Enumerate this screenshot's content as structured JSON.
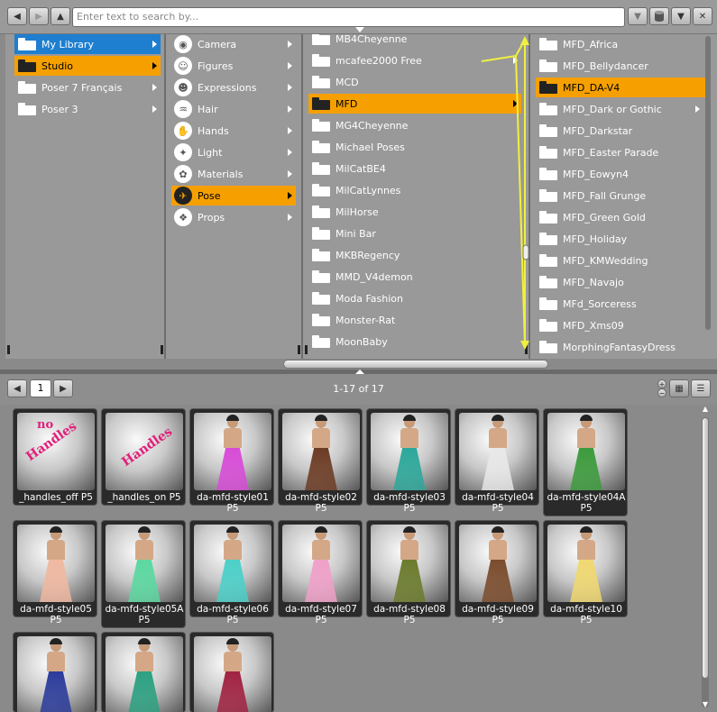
{
  "toolbar": {
    "search_placeholder": "Enter text to search by..."
  },
  "col1": {
    "items": [
      {
        "label": "My Library",
        "state": "selected-blue"
      },
      {
        "label": "Studio",
        "state": "selected"
      },
      {
        "label": "Poser 7 Français",
        "state": ""
      },
      {
        "label": "Poser 3",
        "state": ""
      }
    ]
  },
  "col2": {
    "items": [
      {
        "label": "Camera",
        "icon": "camera-icon"
      },
      {
        "label": "Figures",
        "icon": "figure-icon"
      },
      {
        "label": "Expressions",
        "icon": "face-icon"
      },
      {
        "label": "Hair",
        "icon": "hair-icon"
      },
      {
        "label": "Hands",
        "icon": "hand-icon"
      },
      {
        "label": "Light",
        "icon": "light-icon"
      },
      {
        "label": "Materials",
        "icon": "materials-icon"
      },
      {
        "label": "Pose",
        "icon": "pose-icon",
        "selected": true
      },
      {
        "label": "Props",
        "icon": "props-icon"
      }
    ]
  },
  "col3": {
    "items": [
      {
        "label": "MB4Cheyenne"
      },
      {
        "label": "mcafee2000 Free",
        "arrow": true
      },
      {
        "label": "MCD"
      },
      {
        "label": "MFD",
        "selected": true,
        "arrow": true
      },
      {
        "label": "MG4Cheyenne"
      },
      {
        "label": "Michael Poses"
      },
      {
        "label": "MilCatBE4"
      },
      {
        "label": "MilCatLynnes"
      },
      {
        "label": "MilHorse"
      },
      {
        "label": "Mini Bar"
      },
      {
        "label": "MKBRegency"
      },
      {
        "label": "MMD_V4demon"
      },
      {
        "label": "Moda Fashion"
      },
      {
        "label": "Monster-Rat"
      },
      {
        "label": "MoonBaby"
      }
    ]
  },
  "col4": {
    "items": [
      {
        "label": "MFD_Africa"
      },
      {
        "label": "MFD_Bellydancer"
      },
      {
        "label": "MFD_DA-V4",
        "selected": true
      },
      {
        "label": "MFD_Dark or Gothic",
        "arrow": true
      },
      {
        "label": "MFD_Darkstar"
      },
      {
        "label": "MFD_Easter Parade"
      },
      {
        "label": "MFD_Eowyn4"
      },
      {
        "label": "MFD_Fall Grunge"
      },
      {
        "label": "MFD_Green Gold"
      },
      {
        "label": "MFD_Holiday"
      },
      {
        "label": "MFD_KMWedding"
      },
      {
        "label": "MFD_Navajo"
      },
      {
        "label": "MFd_Sorceress"
      },
      {
        "label": "MFD_Xms09"
      },
      {
        "label": "MorphingFantasyDress"
      }
    ]
  },
  "pager": {
    "page": "1",
    "count": "1-17 of 17"
  },
  "thumbs": [
    {
      "label": "_handles_off P5",
      "kind": "handles-off",
      "text1": "no",
      "text2": "Handles"
    },
    {
      "label": "_handles_on P5",
      "kind": "handles-on",
      "text2": "Handles"
    },
    {
      "label": "da-mfd-style01 P5",
      "dress": "#d84ad8"
    },
    {
      "label": "da-mfd-style02 P5",
      "dress": "#6b3a22"
    },
    {
      "label": "da-mfd-style03 P5",
      "dress": "#2aa79a"
    },
    {
      "label": "da-mfd-style04 P5",
      "dress": "#e8e8e8"
    },
    {
      "label": "da-mfd-style04A P5",
      "dress": "#3a9a3a"
    },
    {
      "label": "da-mfd-style05 P5",
      "dress": "#f0b8a0"
    },
    {
      "label": "da-mfd-style05A P5",
      "dress": "#5ad8a0"
    },
    {
      "label": "da-mfd-style06 P5",
      "dress": "#4ad0c8"
    },
    {
      "label": "da-mfd-style07 P5",
      "dress": "#f0a0c8"
    },
    {
      "label": "da-mfd-style08 P5",
      "dress": "#6a7a2a"
    },
    {
      "label": "da-mfd-style09 P5",
      "dress": "#7a4a2a"
    },
    {
      "label": "da-mfd-style10 P5",
      "dress": "#f0d870"
    },
    {
      "label": "",
      "dress": "#2a3a9a"
    },
    {
      "label": "",
      "dress": "#2aa080"
    },
    {
      "label": "",
      "dress": "#a02040"
    }
  ],
  "colors": {
    "selected": "#f5a000",
    "selected_blue": "#1e7fd0",
    "annotation": "#f0f040"
  }
}
